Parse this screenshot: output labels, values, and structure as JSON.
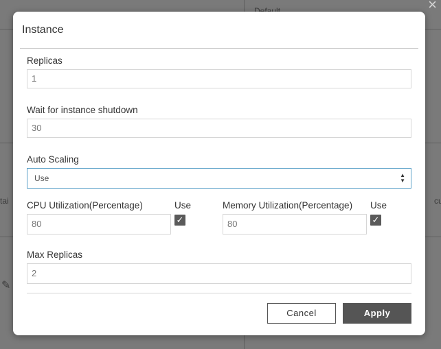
{
  "background": {
    "top_right_text": "Default",
    "left_text": "tai",
    "right_text": "cu"
  },
  "dialog": {
    "title": "Instance",
    "replicas": {
      "label": "Replicas",
      "value": "1"
    },
    "wait_shutdown": {
      "label": "Wait for instance shutdown",
      "value": "30"
    },
    "auto_scaling": {
      "label": "Auto Scaling",
      "selected": "Use"
    },
    "cpu": {
      "label": "CPU Utilization(Percentage)",
      "value": "80",
      "use_label": "Use",
      "use_checked": true
    },
    "memory": {
      "label": "Memory Utilization(Percentage)",
      "value": "80",
      "use_label": "Use",
      "use_checked": true
    },
    "max_replicas": {
      "label": "Max Replicas",
      "value": "2"
    },
    "buttons": {
      "cancel": "Cancel",
      "apply": "Apply"
    }
  }
}
